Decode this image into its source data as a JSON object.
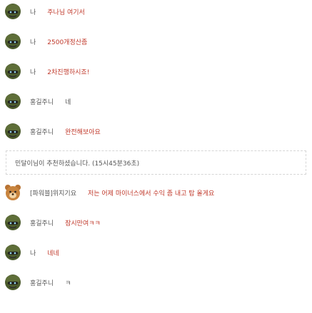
{
  "colors": {
    "message_red": "#c0392b",
    "text_gray": "#555555",
    "avatar_green": "#4b5a2c",
    "avatar_bear": "#b87333"
  },
  "messages": [
    {
      "avatar": "soldier-avatar",
      "nick": "나",
      "text": "주나님 여기서",
      "style": "red"
    },
    {
      "avatar": "soldier-avatar",
      "nick": "나",
      "text": "2500개정산좀",
      "style": "red"
    },
    {
      "avatar": "soldier-avatar",
      "nick": "나",
      "text": "2차진행하시죠!",
      "style": "red"
    },
    {
      "avatar": "soldier-avatar",
      "nick": "홍길주니",
      "text": "네",
      "style": "gray"
    },
    {
      "avatar": "soldier-avatar",
      "nick": "홍길주니",
      "text": "완전해보아요",
      "style": "red"
    }
  ],
  "notice": {
    "text": "민달이님이 추천하셨습니다. (15시45분36초)"
  },
  "messages2": [
    {
      "avatar": "bear-avatar",
      "nick": "[파워블]위지기요",
      "text": "저는 어제 마이너스에서 수익 좀 내고 탑 올게요",
      "style": "red"
    },
    {
      "avatar": "soldier-avatar",
      "nick": "홍길주니",
      "text": "잠시만여ㅋㅋ",
      "style": "red"
    },
    {
      "avatar": "soldier-avatar",
      "nick": "나",
      "text": "네네",
      "style": "red"
    },
    {
      "avatar": "soldier-avatar",
      "nick": "홍길주니",
      "text": "ㅋ",
      "style": "gray"
    }
  ]
}
